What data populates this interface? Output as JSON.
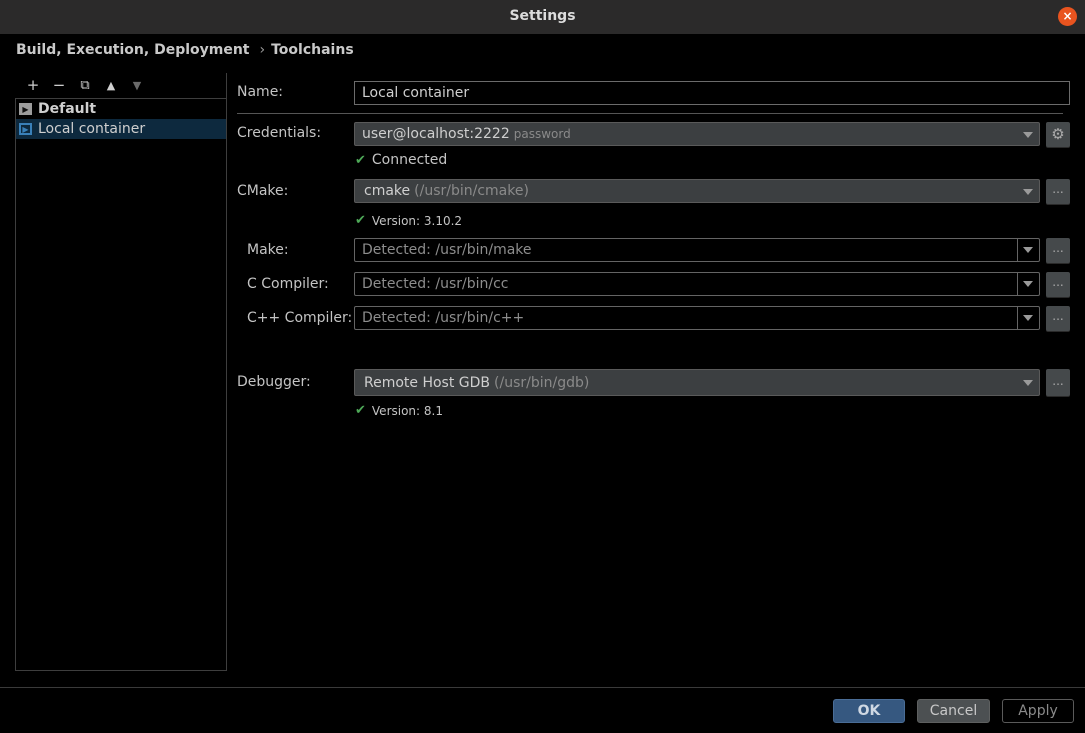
{
  "window": {
    "title": "Settings",
    "close_icon": "×"
  },
  "breadcrumb": {
    "parent": "Build, Execution, Deployment",
    "separator": "›",
    "current": "Toolchains"
  },
  "toolbar": {
    "add": "+",
    "remove": "−",
    "copy": "⧉",
    "up": "▲",
    "down": "▼"
  },
  "toolchains": [
    {
      "name": "Default",
      "icon": "▶"
    },
    {
      "name": "Local container",
      "icon": "▶"
    }
  ],
  "form": {
    "name_label": "Name:",
    "name_value": "Local container",
    "credentials_label": "Credentials:",
    "credentials_value": "user@localhost:2222",
    "credentials_hint": "password",
    "credentials_status": "Connected",
    "cmake_label": "CMake:",
    "cmake_value": "cmake",
    "cmake_path": "(/usr/bin/cmake)",
    "cmake_status": "Version: 3.10.2",
    "make_label": "Make:",
    "make_value": "Detected: /usr/bin/make",
    "c_compiler_label": "C Compiler:",
    "c_compiler_value": "Detected: /usr/bin/cc",
    "cpp_compiler_label": "C++ Compiler:",
    "cpp_compiler_value": "Detected: /usr/bin/c++",
    "debugger_label": "Debugger:",
    "debugger_value": "Remote Host GDB",
    "debugger_path": "(/usr/bin/gdb)",
    "debugger_status": "Version: 8.1",
    "browse_label": "...",
    "check_glyph": "✔",
    "gear_glyph": "⚙"
  },
  "buttons": {
    "ok": "OK",
    "cancel": "Cancel",
    "apply": "Apply"
  }
}
